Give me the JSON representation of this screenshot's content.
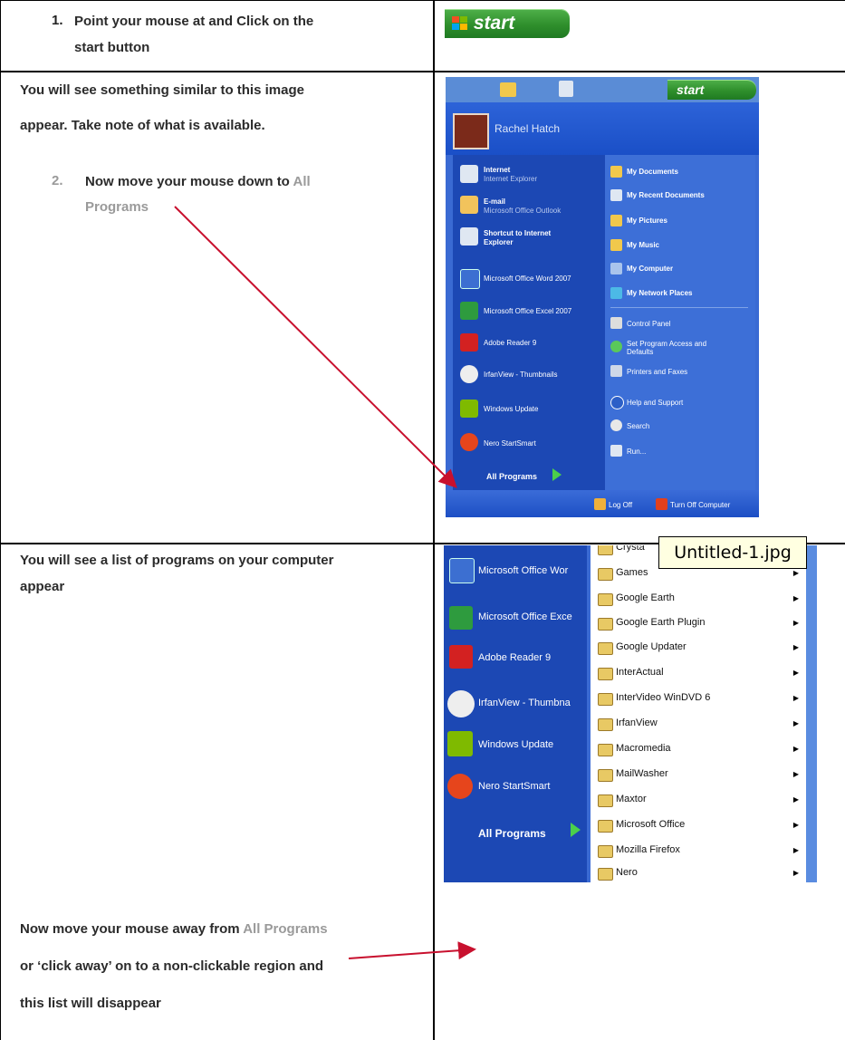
{
  "steps": {
    "step1_number": "1.",
    "step1_text_a": "Point your mouse at and Click on the",
    "step1_text_b": "start button",
    "row2_line1": "You will see something similar to this image",
    "row2_line2": "appear.  Take note of what is available.",
    "step2_number": "2.",
    "step2_text_a": "Now move your mouse down to",
    "step2_highlight_a": "All",
    "step2_highlight_b": "Programs",
    "row3_line1": "You will see a list of programs on your computer",
    "row3_line2": "appear",
    "row4_line1_a": "Now move your mouse away from",
    "row4_line1_hl": "All Programs",
    "row4_line2": "or ‘click away’ on to a non-clickable region and",
    "row4_line3": "this list will disappear"
  },
  "start_button": {
    "label": "start"
  },
  "start_menu": {
    "start_label": "start",
    "user_name": "Rachel Hatch",
    "pinned": [
      {
        "title": "Internet",
        "subtitle": "Internet Explorer"
      },
      {
        "title": "E-mail",
        "subtitle": "Microsoft Office Outlook"
      },
      {
        "title": "Shortcut to Internet",
        "subtitle": "Explorer"
      }
    ],
    "recent": [
      "Microsoft Office Word 2007",
      "Microsoft Office Excel 2007",
      "Adobe Reader 9",
      "IrfanView - Thumbnails",
      "Windows Update",
      "Nero StartSmart"
    ],
    "all_programs": "All Programs",
    "right_items": [
      "My Documents",
      "My Recent Documents",
      "My Pictures",
      "My Music",
      "My Computer",
      "My Network Places",
      "Control Panel",
      "Set Program Access and",
      "Defaults",
      "Printers and Faxes",
      "Help and Support",
      "Search",
      "Run..."
    ],
    "log_off": "Log Off",
    "turn_off": "Turn Off Computer"
  },
  "programs_menu": {
    "left_items": [
      "Microsoft Office Wor",
      "Microsoft Office Exce",
      "Adobe Reader 9",
      "IrfanView - Thumbna",
      "Windows Update",
      "Nero StartSmart"
    ],
    "all_programs": "All Programs",
    "folders": [
      "Crysta",
      "Games",
      "Google Earth",
      "Google Earth Plugin",
      "Google Updater",
      "InterActual",
      "InterVideo WinDVD 6",
      "IrfanView",
      "Macromedia",
      "MailWasher",
      "Maxtor",
      "Microsoft Office",
      "Mozilla Firefox",
      "Nero"
    ],
    "tooltip": "Untitled-1.jpg"
  },
  "colors": {
    "xp_blue": "#3a6ad3",
    "xp_green": "#2f8f2c",
    "arrow_red": "#c8102e",
    "highlight_grey": "#9a9a9a"
  }
}
